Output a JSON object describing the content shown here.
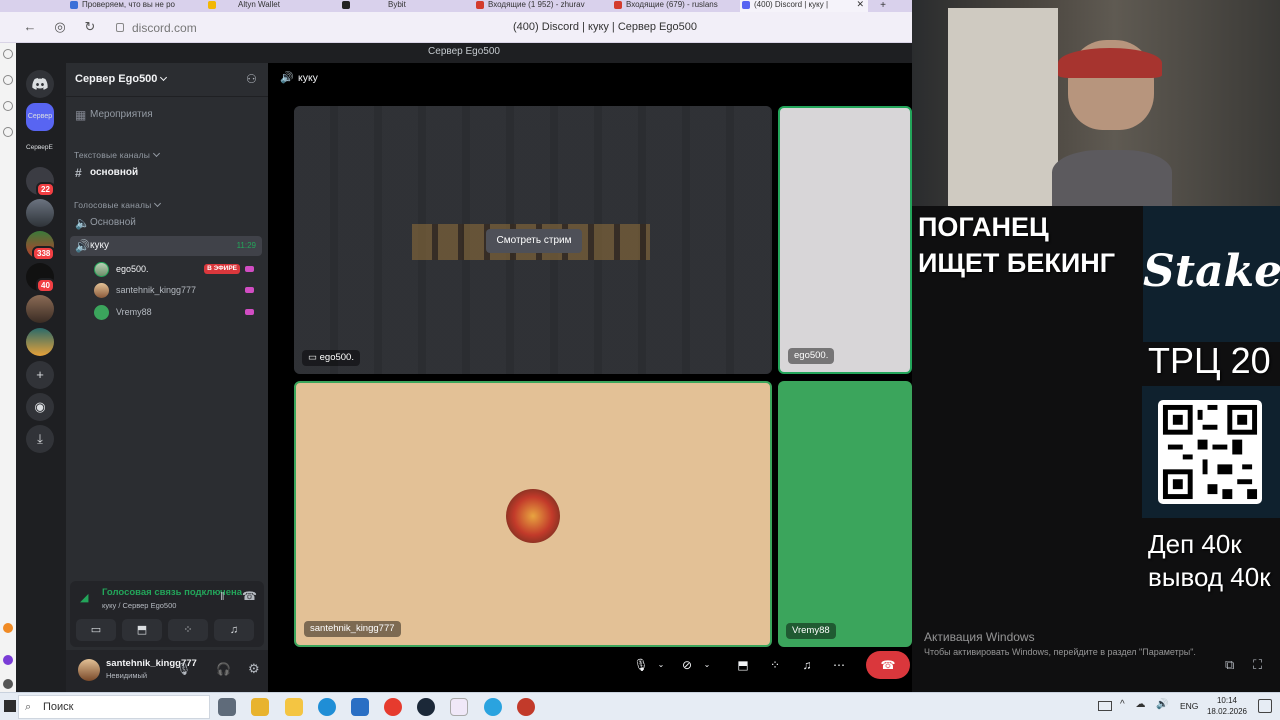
{
  "browser": {
    "tabs": [
      {
        "label": "Проверяем, что вы не ро"
      },
      {
        "label": "Altyn Wallet"
      },
      {
        "label": "Bybit"
      },
      {
        "label": "Входящие (1 952) - zhurav"
      },
      {
        "label": "Входящие (679) - ruslans"
      },
      {
        "label": "(400) Discord | куку |"
      }
    ],
    "url": "discord.com",
    "page_title": "(400) Discord | куку | Сервер Ego500"
  },
  "discord": {
    "window_title": "Сервер Ego500",
    "guild_badges": [
      "22",
      "338",
      "40"
    ],
    "guild_labels": [
      "Сервер",
      "СерверЕ"
    ],
    "server_name": "Сервер Ego500",
    "events_label": "Мероприятия",
    "text_category": "Текстовые каналы",
    "text_channel": "основной",
    "voice_category": "Голосовые каналы",
    "voice_channel_1": "Основной",
    "voice_channel_2": "куку",
    "voice_channel_2_time": "11:29",
    "voice_users": [
      {
        "name": "ego500.",
        "live": "В ЭФИРЕ"
      },
      {
        "name": "santehnik_kingg777"
      },
      {
        "name": "Vremy88"
      }
    ],
    "voice_status": "Голосовая связь подключена",
    "voice_sub": "куку / Сервер Ego500",
    "user_name": "santehnik_kingg777",
    "user_status": "Невидимый",
    "stage_channel": "куку",
    "tiles": [
      {
        "name": "ego500.",
        "action": "Смотреть стрим"
      },
      {
        "name": "ego500."
      },
      {
        "name": "santehnik_kingg777"
      },
      {
        "name": "Vremy88"
      }
    ]
  },
  "windows_activation": {
    "title": "Активация Windows",
    "message": "Чтобы активировать Windows, перейдите в раздел \"Параметры\"."
  },
  "overlay": {
    "banner_line1": "ПОГАНЕЦ",
    "banner_line2": "ИЩЕТ БЕКИНГ",
    "brand": "Stake",
    "trc": "ТРЦ 20",
    "dep": "Деп 40к",
    "vyvod": "вывод 40к"
  },
  "taskbar": {
    "search_placeholder": "Поиск",
    "lang": "ENG",
    "time": "10:14",
    "date": "18.02.2026"
  },
  "colors": {
    "discord_green": "#23a55a",
    "blurple": "#5865f2",
    "tile_peach": "#e3c196",
    "tile_green": "#3ba55c",
    "live_red": "#da373c"
  }
}
